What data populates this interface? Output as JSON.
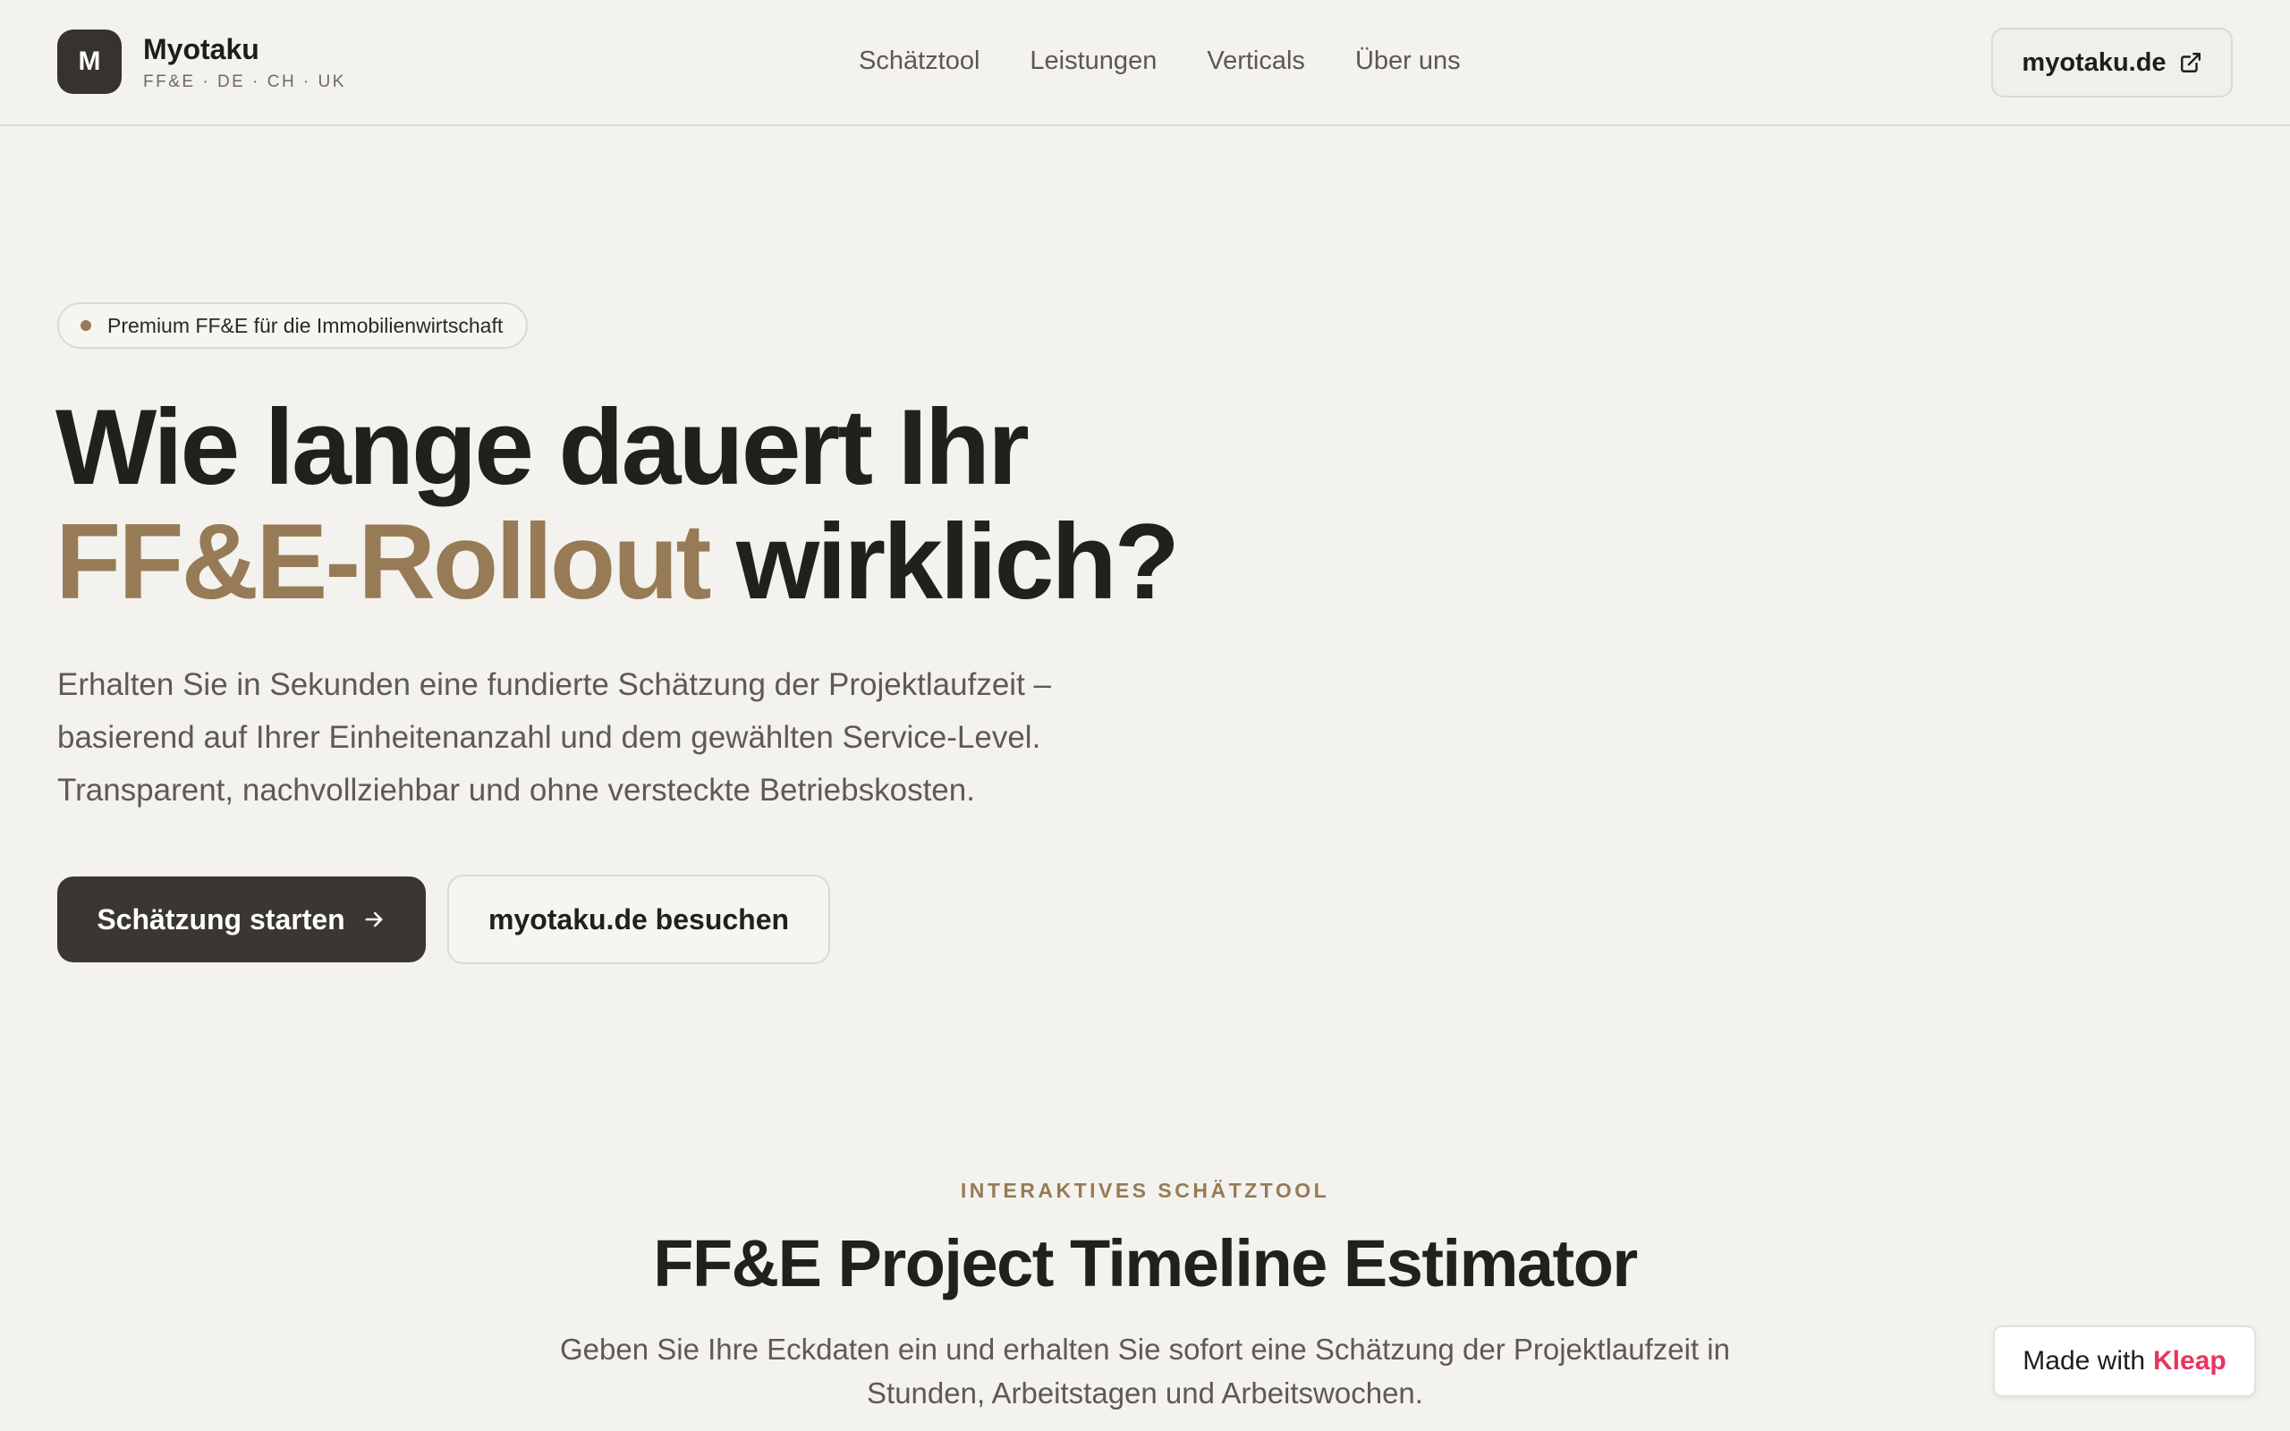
{
  "header": {
    "logo_letter": "M",
    "brand_name": "Myotaku",
    "brand_sub": "FF&E · DE · CH · UK",
    "nav": [
      {
        "label": "Schätztool"
      },
      {
        "label": "Leistungen"
      },
      {
        "label": "Verticals"
      },
      {
        "label": "Über uns"
      }
    ],
    "external_link_label": "myotaku.de"
  },
  "hero": {
    "badge": "Premium FF&E für die Immobilienwirtschaft",
    "title_line1": "Wie lange dauert Ihr",
    "title_accent": "FF&E-Rollout",
    "title_rest": "wirklich?",
    "lead_line1": "Erhalten Sie in Sekunden eine fundierte Schätzung der Projektlaufzeit –",
    "lead_line2": "basierend auf Ihrer Einheitenanzahl und dem gewählten Service-Level.",
    "lead_line3": "Transparent, nachvollziehbar und ohne versteckte Betriebskosten.",
    "primary_button": "Schätzung starten",
    "secondary_button": "myotaku.de besuchen"
  },
  "section": {
    "eyebrow": "INTERAKTIVES SCHÄTZTOOL",
    "title": "FF&E Project Timeline Estimator",
    "lead_line1": "Geben Sie Ihre Eckdaten ein und erhalten Sie sofort eine Schätzung der Projektlaufzeit in",
    "lead_line2": "Stunden, Arbeitstagen und Arbeitswochen."
  },
  "made_with": {
    "prefix": "Made with",
    "brand": "Kleap"
  },
  "colors": {
    "accent": "#967b56",
    "dark": "#3a3631",
    "background": "#f4f2ee",
    "kleap": "#e8345f"
  }
}
